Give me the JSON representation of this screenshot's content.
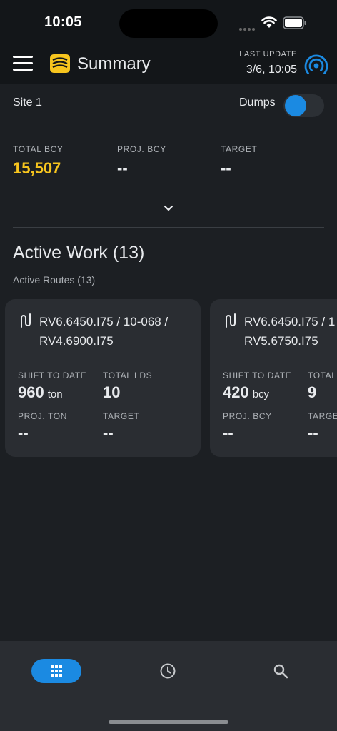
{
  "status_bar": {
    "time": "10:05"
  },
  "header": {
    "title": "Summary",
    "last_update_label": "LAST UPDATE",
    "last_update_value": "3/6, 10:05"
  },
  "site": {
    "name": "Site 1"
  },
  "dumps_toggle": {
    "label": "Dumps",
    "on": true
  },
  "stats": [
    {
      "label": "TOTAL BCY",
      "value": "15,507"
    },
    {
      "label": "PROJ. BCY",
      "value": "--"
    },
    {
      "label": "TARGET",
      "value": "--"
    }
  ],
  "active_work": {
    "title": "Active Work (13)",
    "subtitle": "Active Routes (13)"
  },
  "routes": [
    {
      "line1": "RV6.6450.I75 / 10-068 /",
      "line2": "RV4.6900.I75",
      "shift_label": "SHIFT TO DATE",
      "shift_value": "960",
      "shift_unit": "ton",
      "loads_label": "TOTAL LDS",
      "loads_value": "10",
      "proj_label": "PROJ. TON",
      "proj_value": "--",
      "target_label": "TARGET",
      "target_value": "--"
    },
    {
      "line1": "RV6.6450.I75 / 1",
      "line2": "RV5.6750.I75",
      "shift_label": "SHIFT TO DATE",
      "shift_value": "420",
      "shift_unit": "bcy",
      "loads_label": "TOTAL",
      "loads_value": "9",
      "proj_label": "PROJ. BCY",
      "proj_value": "--",
      "target_label": "TARGE",
      "target_value": "--"
    }
  ],
  "colors": {
    "accent": "#1b8ae2",
    "highlight": "#f7c51e",
    "background": "#131619",
    "card": "#2a2d32"
  },
  "nav": [
    {
      "icon": "grid-icon",
      "active": true
    },
    {
      "icon": "history-icon",
      "active": false
    },
    {
      "icon": "search-icon",
      "active": false
    }
  ]
}
